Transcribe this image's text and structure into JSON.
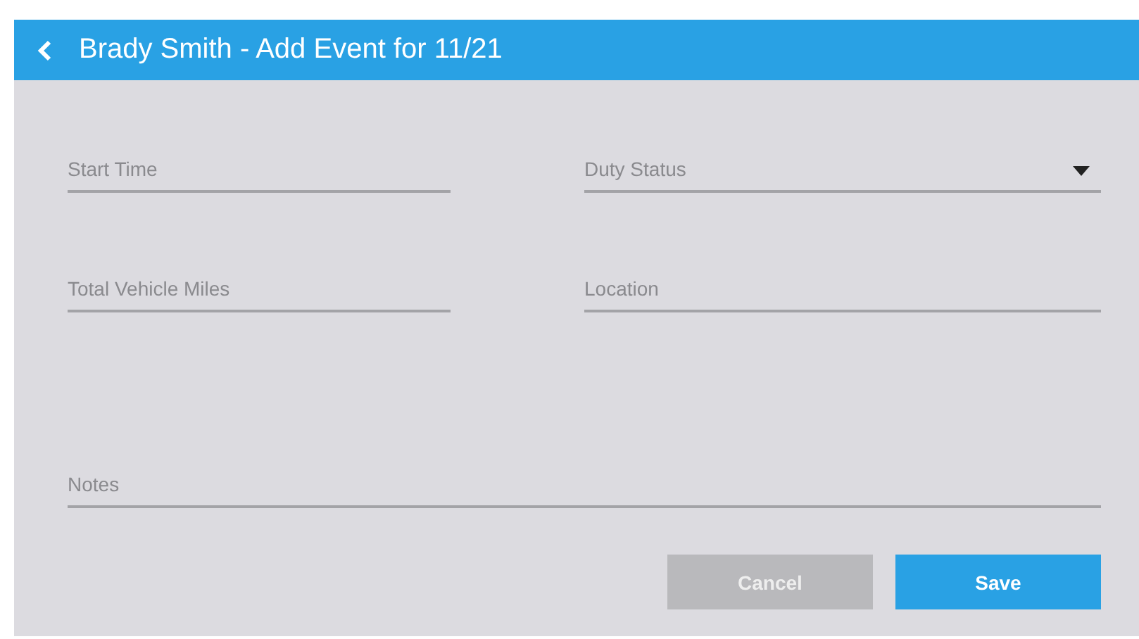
{
  "header": {
    "title": "Brady Smith - Add Event for 11/21"
  },
  "fields": [
    {
      "placeholder": "Start Time",
      "kind": "text"
    },
    {
      "placeholder": "Duty Status",
      "kind": "select"
    },
    {
      "placeholder": "Total Vehicle Miles",
      "kind": "text"
    },
    {
      "placeholder": "Location",
      "kind": "text"
    },
    {
      "placeholder": "Notes",
      "kind": "wide"
    }
  ],
  "buttons": [
    {
      "label": "Cancel",
      "disabled": true
    },
    {
      "label": "Save",
      "disabled": false
    }
  ]
}
